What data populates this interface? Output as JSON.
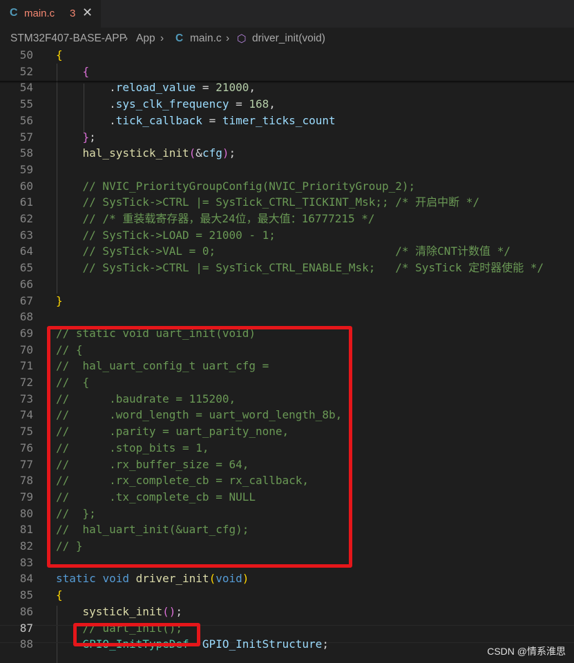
{
  "tab": {
    "icon": "C",
    "filename": "main.c",
    "problem_count": "3",
    "close": "✕"
  },
  "breadcrumb": {
    "project": "STM32F407-BASE-APP",
    "sep1": "›",
    "folder": "App",
    "sep2": "›",
    "file_icon": "C",
    "file": "main.c",
    "sep3": "›",
    "symbol_icon": "⬡",
    "symbol": "driver_init(void)"
  },
  "lines": [
    {
      "n": "50",
      "segs": [
        {
          "t": "{",
          "c": "br1"
        }
      ]
    },
    {
      "n": "52",
      "segs": [
        {
          "t": "    "
        },
        {
          "t": "{",
          "c": "br2"
        }
      ]
    },
    {
      "n": "54",
      "segs": [
        {
          "t": "        ."
        },
        {
          "t": "reload_value",
          "c": "var"
        },
        {
          "t": " = "
        },
        {
          "t": "21000",
          "c": "num"
        },
        {
          "t": ","
        }
      ]
    },
    {
      "n": "55",
      "segs": [
        {
          "t": "        ."
        },
        {
          "t": "sys_clk_frequency",
          "c": "var"
        },
        {
          "t": " = "
        },
        {
          "t": "168",
          "c": "num"
        },
        {
          "t": ","
        }
      ]
    },
    {
      "n": "56",
      "segs": [
        {
          "t": "        ."
        },
        {
          "t": "tick_callback",
          "c": "var"
        },
        {
          "t": " = "
        },
        {
          "t": "timer_ticks_count",
          "c": "var"
        }
      ]
    },
    {
      "n": "57",
      "segs": [
        {
          "t": "    "
        },
        {
          "t": "}",
          "c": "br2"
        },
        {
          "t": ";"
        }
      ]
    },
    {
      "n": "58",
      "segs": [
        {
          "t": "    "
        },
        {
          "t": "hal_systick_init",
          "c": "fn"
        },
        {
          "t": "(",
          "c": "br2"
        },
        {
          "t": "&"
        },
        {
          "t": "cfg",
          "c": "var"
        },
        {
          "t": ")",
          "c": "br2"
        },
        {
          "t": ";"
        }
      ]
    },
    {
      "n": "59",
      "segs": []
    },
    {
      "n": "60",
      "segs": [
        {
          "t": "    // NVIC_PriorityGroupConfig(NVIC_PriorityGroup_2);",
          "c": "cm"
        }
      ]
    },
    {
      "n": "61",
      "segs": [
        {
          "t": "    // SysTick->CTRL |= SysTick_CTRL_TICKINT_Msk;; /* 开启中断 */",
          "c": "cm"
        }
      ]
    },
    {
      "n": "62",
      "segs": [
        {
          "t": "    // /* 重装载寄存器，最大24位，最大值：16777215 */",
          "c": "cm"
        }
      ]
    },
    {
      "n": "63",
      "segs": [
        {
          "t": "    // SysTick->LOAD = 21000 - 1;",
          "c": "cm"
        }
      ]
    },
    {
      "n": "64",
      "segs": [
        {
          "t": "    // SysTick->VAL = 0;                           /* 清除CNT计数值 */",
          "c": "cm"
        }
      ]
    },
    {
      "n": "65",
      "segs": [
        {
          "t": "    // SysTick->CTRL |= SysTick_CTRL_ENABLE_Msk;   /* SysTick 定时器使能 */",
          "c": "cm"
        }
      ]
    },
    {
      "n": "66",
      "segs": []
    },
    {
      "n": "67",
      "segs": [
        {
          "t": "}",
          "c": "br1"
        }
      ]
    },
    {
      "n": "68",
      "segs": []
    },
    {
      "n": "69",
      "segs": [
        {
          "t": "// static void uart_init(void)",
          "c": "cm"
        }
      ]
    },
    {
      "n": "70",
      "segs": [
        {
          "t": "// {",
          "c": "cm"
        }
      ]
    },
    {
      "n": "71",
      "segs": [
        {
          "t": "//  hal_uart_config_t uart_cfg =",
          "c": "cm"
        }
      ]
    },
    {
      "n": "72",
      "segs": [
        {
          "t": "//  {",
          "c": "cm"
        }
      ]
    },
    {
      "n": "73",
      "segs": [
        {
          "t": "//      .baudrate = 115200,",
          "c": "cm"
        }
      ]
    },
    {
      "n": "74",
      "segs": [
        {
          "t": "//      .word_length = uart_word_length_8b,",
          "c": "cm"
        }
      ]
    },
    {
      "n": "75",
      "segs": [
        {
          "t": "//      .parity = uart_parity_none,",
          "c": "cm"
        }
      ]
    },
    {
      "n": "76",
      "segs": [
        {
          "t": "//      .stop_bits = 1,",
          "c": "cm"
        }
      ]
    },
    {
      "n": "77",
      "segs": [
        {
          "t": "//      .rx_buffer_size = 64,",
          "c": "cm"
        }
      ]
    },
    {
      "n": "78",
      "segs": [
        {
          "t": "//      .rx_complete_cb = rx_callback,",
          "c": "cm"
        }
      ]
    },
    {
      "n": "79",
      "segs": [
        {
          "t": "//      .tx_complete_cb = NULL",
          "c": "cm"
        }
      ]
    },
    {
      "n": "80",
      "segs": [
        {
          "t": "//  };",
          "c": "cm"
        }
      ]
    },
    {
      "n": "81",
      "segs": [
        {
          "t": "//  hal_uart_init(&uart_cfg);",
          "c": "cm"
        }
      ]
    },
    {
      "n": "82",
      "segs": [
        {
          "t": "// }",
          "c": "cm"
        }
      ]
    },
    {
      "n": "83",
      "segs": []
    },
    {
      "n": "84",
      "segs": [
        {
          "t": "static",
          "c": "kw"
        },
        {
          "t": " "
        },
        {
          "t": "void",
          "c": "kw"
        },
        {
          "t": " "
        },
        {
          "t": "driver_init",
          "c": "fn"
        },
        {
          "t": "(",
          "c": "br1"
        },
        {
          "t": "void",
          "c": "kw"
        },
        {
          "t": ")",
          "c": "br1"
        }
      ]
    },
    {
      "n": "85",
      "segs": [
        {
          "t": "{",
          "c": "br1"
        }
      ]
    },
    {
      "n": "86",
      "segs": [
        {
          "t": "    "
        },
        {
          "t": "systick_init",
          "c": "fn"
        },
        {
          "t": "(",
          "c": "br2"
        },
        {
          "t": ")",
          "c": "br2"
        },
        {
          "t": ";"
        }
      ]
    },
    {
      "n": "87",
      "segs": [
        {
          "t": "    // uart_init();",
          "c": "cm"
        }
      ]
    },
    {
      "n": "88",
      "segs": [
        {
          "t": "    "
        },
        {
          "t": "GPIO_InitTypeDef",
          "c": "ty"
        },
        {
          "t": "  "
        },
        {
          "t": "GPIO_InitStructure",
          "c": "var"
        },
        {
          "t": ";"
        }
      ]
    }
  ],
  "active_line": "87",
  "watermark": "CSDN @情系淮思"
}
